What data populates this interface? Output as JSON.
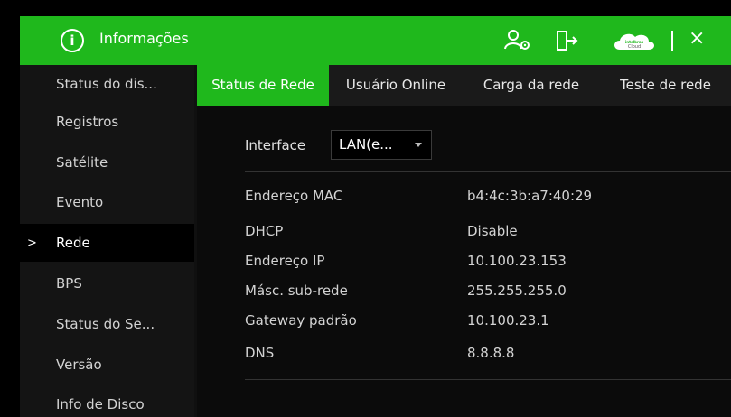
{
  "titlebar": {
    "title": "Informações",
    "info_glyph": "i",
    "cloud_logo_top": "intelbras",
    "cloud_logo_bottom": "Cloud",
    "close_glyph": "×"
  },
  "sidebar": {
    "active_marker": ">",
    "items": [
      {
        "label": "Status do dis..."
      },
      {
        "label": "Registros"
      },
      {
        "label": "Satélite"
      },
      {
        "label": "Evento"
      },
      {
        "label": "Rede"
      },
      {
        "label": "BPS"
      },
      {
        "label": "Status do Se..."
      },
      {
        "label": "Versão"
      },
      {
        "label": "Info de Disco"
      }
    ],
    "active_index": 4
  },
  "tabs": [
    {
      "label": "Status de Rede"
    },
    {
      "label": "Usuário Online"
    },
    {
      "label": "Carga da rede"
    },
    {
      "label": "Teste de rede"
    }
  ],
  "active_tab": 0,
  "network": {
    "interface_label": "Interface",
    "interface_value": "LAN(e...",
    "rows": [
      {
        "label": "Endereço MAC",
        "value": "b4:4c:3b:a7:40:29"
      },
      {
        "label": "DHCP",
        "value": "Disable"
      },
      {
        "label": "Endereço IP",
        "value": "10.100.23.153"
      },
      {
        "label": "Másc. sub-rede",
        "value": "255.255.255.0"
      },
      {
        "label": "Gateway padrão",
        "value": "10.100.23.1"
      },
      {
        "label": "DNS",
        "value": "8.8.8.8"
      }
    ]
  },
  "colors": {
    "accent": "#1fb81c",
    "background": "#101010"
  }
}
